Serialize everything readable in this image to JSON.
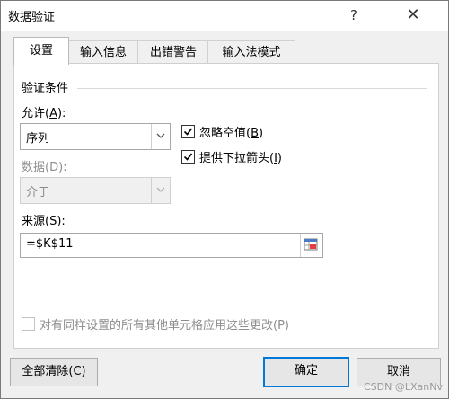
{
  "window": {
    "title": "数据验证",
    "help": "?",
    "close": "✕"
  },
  "tabs": [
    "设置",
    "输入信息",
    "出错警告",
    "输入法模式"
  ],
  "settings": {
    "group_label": "验证条件",
    "allow": {
      "label": "允许(",
      "hotkey": "A",
      "suffix": "):",
      "value": "序列"
    },
    "data": {
      "label": "数据(D):",
      "value": "介于"
    },
    "ignore_blank": {
      "label": "忽略空值(",
      "hotkey": "B",
      "suffix": ")",
      "checked": true
    },
    "dropdown": {
      "label": "提供下拉箭头(",
      "hotkey": "I",
      "suffix": ")",
      "checked": true
    },
    "source": {
      "label": "来源(",
      "hotkey": "S",
      "suffix": "):",
      "value": "=$K$11"
    },
    "apply_all": {
      "label": "对有同样设置的所有其他单元格应用这些更改(P)",
      "checked": false
    }
  },
  "buttons": {
    "clear_all": "全部清除(C)",
    "ok": "确定",
    "cancel": "取消"
  },
  "watermark": "CSDN @LXanNv"
}
